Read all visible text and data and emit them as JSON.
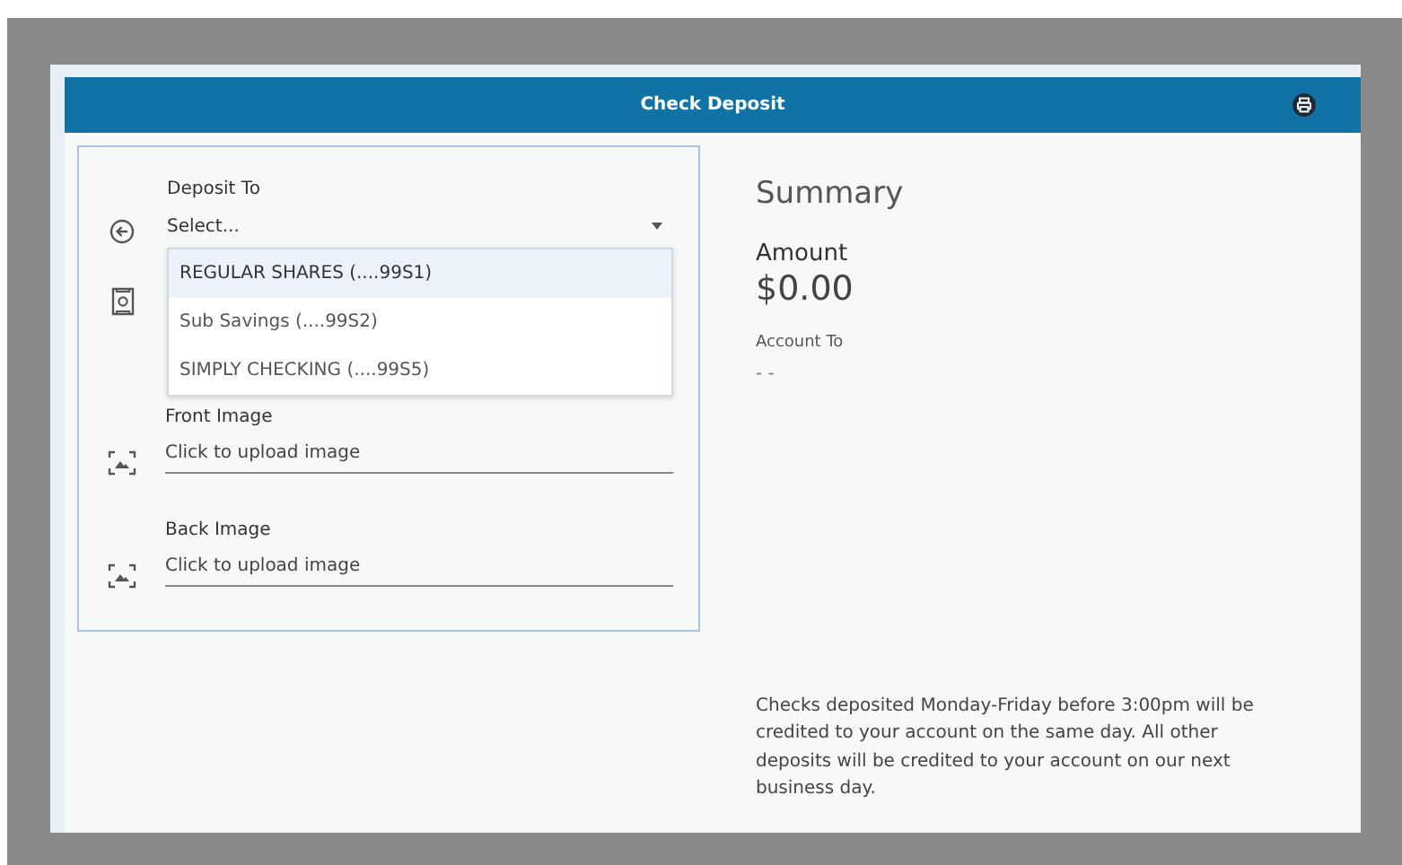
{
  "header": {
    "title": "Check Deposit"
  },
  "fields": [
    {
      "kind": "select",
      "label": "Deposit To",
      "value": "Select...",
      "expanded": true,
      "options": [
        {
          "label": "REGULAR SHARES (....99S1)",
          "selected": true
        },
        {
          "label": "Sub Savings (....99S2)",
          "selected": false
        },
        {
          "label": "SIMPLY CHECKING (....99S5)",
          "selected": false
        }
      ]
    },
    {
      "kind": "amount"
    },
    {
      "kind": "image",
      "label": "Front Image",
      "placeholder": "Click to upload image"
    },
    {
      "kind": "image",
      "label": "Back Image",
      "placeholder": "Click to upload image"
    }
  ],
  "summary": {
    "title": "Summary",
    "amount_label": "Amount",
    "amount": "$0.00",
    "account_label": "Account To",
    "account": "- -"
  },
  "note": "Checks deposited Monday-Friday before 3:00pm will be credited to your account on the same day. All other deposits will be credited to your account on our next business day."
}
